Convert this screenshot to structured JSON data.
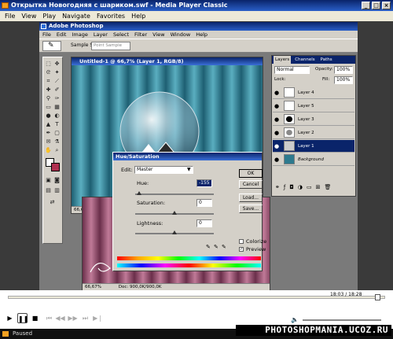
{
  "window": {
    "title": "Открытка Новогодняя с шариком.swf - Media Player Classic"
  },
  "menu": [
    "File",
    "View",
    "Play",
    "Navigate",
    "Favorites",
    "Help"
  ],
  "photoshop": {
    "title": "Adobe Photoshop",
    "menu": [
      "File",
      "Edit",
      "Image",
      "Layer",
      "Select",
      "Filter",
      "View",
      "Window",
      "Help"
    ],
    "options": {
      "sample_label": "Sample Size:",
      "sample_value": "Point Sample"
    },
    "doc1": {
      "title": "Untitled-1 @ 66,7% (Layer 1, RGB/8)",
      "zoom": "66,67%"
    },
    "doc2": {
      "zoom": "66,67%",
      "doc_info": "Doc: 900,0K/900,0K"
    }
  },
  "layers_panel": {
    "tabs": [
      "Layers",
      "Channels",
      "Paths"
    ],
    "blend": "Normal",
    "opacity_label": "Opacity:",
    "opacity": "100%",
    "lock_label": "Lock:",
    "fill_label": "Fill:",
    "fill": "100%",
    "layers": [
      {
        "name": "Layer 4",
        "selected": false
      },
      {
        "name": "Layer 5",
        "selected": false
      },
      {
        "name": "Layer 3",
        "selected": false
      },
      {
        "name": "Layer 2",
        "selected": false
      },
      {
        "name": "Layer 1",
        "selected": true
      },
      {
        "name": "Background",
        "selected": false
      }
    ]
  },
  "hue_sat": {
    "title": "Hue/Saturation",
    "edit_label": "Edit:",
    "edit_value": "Master",
    "hue_label": "Hue:",
    "hue_value": "-155",
    "saturation_label": "Saturation:",
    "saturation_value": "0",
    "lightness_label": "Lightness:",
    "lightness_value": "0",
    "ok": "OK",
    "cancel": "Cancel",
    "load": "Load...",
    "save": "Save...",
    "colorize": "Colorize",
    "preview": "Preview",
    "preview_checked": true,
    "colorize_checked": false
  },
  "player": {
    "time": "18:03 / 18:28",
    "status": "Paused",
    "watermark": "PHOTOSHOPMANIA.UCOZ.RU"
  },
  "colors": {
    "title_bar": "#0a246a",
    "curtain": "#2d7a8e",
    "curtain_pink": "#a05a78"
  }
}
